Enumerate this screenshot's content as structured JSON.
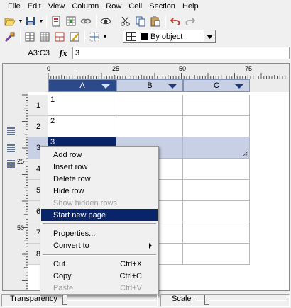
{
  "menubar": {
    "items": [
      "File",
      "Edit",
      "View",
      "Column",
      "Row",
      "Cell",
      "Section",
      "Help"
    ]
  },
  "toolbar": {
    "border_style": "By object"
  },
  "formula": {
    "cell_ref": "A3:C3",
    "fx_label": "fx",
    "value": "3"
  },
  "ruler": {
    "h_labels": [
      "0",
      "25",
      "50",
      "75"
    ],
    "v_labels": [
      "25",
      "50"
    ]
  },
  "columns": [
    "A",
    "B",
    "C"
  ],
  "rows": [
    {
      "num": "1",
      "a": "1"
    },
    {
      "num": "2",
      "a": "2"
    },
    {
      "num": "3",
      "a": "3"
    },
    {
      "num": "4",
      "a": ""
    },
    {
      "num": "5",
      "a": ""
    },
    {
      "num": "6",
      "a": ""
    },
    {
      "num": "7",
      "a": ""
    },
    {
      "num": "8",
      "a": ""
    }
  ],
  "context_menu": {
    "items": [
      {
        "label": "Add row",
        "shortcut": "",
        "disabled": false
      },
      {
        "label": "Insert row",
        "shortcut": "",
        "disabled": false
      },
      {
        "label": "Delete row",
        "shortcut": "",
        "disabled": false
      },
      {
        "label": "Hide row",
        "shortcut": "",
        "disabled": false
      },
      {
        "label": "Show hidden rows",
        "shortcut": "",
        "disabled": true
      },
      {
        "label": "Start new page",
        "shortcut": "",
        "disabled": false,
        "highlighted": true
      },
      {
        "label": "Properties...",
        "shortcut": "",
        "disabled": false
      },
      {
        "label": "Convert to",
        "shortcut": "",
        "disabled": false,
        "submenu": true
      },
      {
        "label": "Cut",
        "shortcut": "Ctrl+X",
        "disabled": false
      },
      {
        "label": "Copy",
        "shortcut": "Ctrl+C",
        "disabled": false
      },
      {
        "label": "Paste",
        "shortcut": "Ctrl+V",
        "disabled": true
      }
    ]
  },
  "statusbar": {
    "transparency_label": "Transparency",
    "scale_label": "Scale"
  },
  "colors": {
    "selection_dark": "#0a246a",
    "selection_light": "#c8d0e6",
    "header_blue": "#2c4a8a"
  }
}
